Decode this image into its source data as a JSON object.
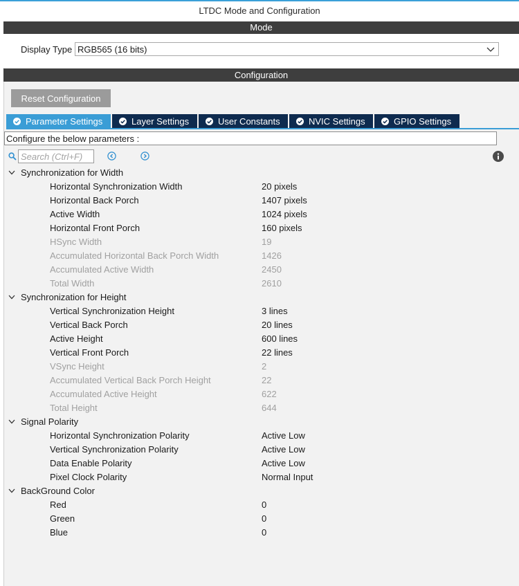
{
  "window": {
    "title": "LTDC Mode and Configuration"
  },
  "mode": {
    "header": "Mode",
    "display_type_label": "Display Type",
    "display_type_value": "RGB565 (16 bits)"
  },
  "configuration": {
    "header": "Configuration",
    "reset_button": "Reset Configuration",
    "tabs": [
      {
        "label": "Parameter Settings",
        "active": true
      },
      {
        "label": "Layer Settings",
        "active": false
      },
      {
        "label": "User Constants",
        "active": false
      },
      {
        "label": "NVIC Settings",
        "active": false
      },
      {
        "label": "GPIO Settings",
        "active": false
      }
    ],
    "info_text": "Configure the below parameters :",
    "search_placeholder": "Search (Ctrl+F)",
    "groups": [
      {
        "name": "Synchronization for Width",
        "items": [
          {
            "label": "Horizontal Synchronization Width",
            "value": "20 pixels",
            "enabled": true
          },
          {
            "label": "Horizontal Back Porch",
            "value": "1407 pixels",
            "enabled": true
          },
          {
            "label": "Active Width",
            "value": "1024 pixels",
            "enabled": true
          },
          {
            "label": "Horizontal Front Porch",
            "value": "160 pixels",
            "enabled": true
          },
          {
            "label": "HSync Width",
            "value": "19",
            "enabled": false
          },
          {
            "label": "Accumulated Horizontal Back Porch Width",
            "value": "1426",
            "enabled": false
          },
          {
            "label": "Accumulated Active Width",
            "value": "2450",
            "enabled": false
          },
          {
            "label": "Total Width",
            "value": "2610",
            "enabled": false
          }
        ]
      },
      {
        "name": "Synchronization for Height",
        "items": [
          {
            "label": "Vertical Synchronization Height",
            "value": "3 lines",
            "enabled": true
          },
          {
            "label": "Vertical Back Porch",
            "value": "20 lines",
            "enabled": true
          },
          {
            "label": "Active Height",
            "value": "600 lines",
            "enabled": true
          },
          {
            "label": "Vertical Front Porch",
            "value": "22 lines",
            "enabled": true
          },
          {
            "label": "VSync Height",
            "value": "2",
            "enabled": false
          },
          {
            "label": "Accumulated Vertical Back Porch Height",
            "value": "22",
            "enabled": false
          },
          {
            "label": "Accumulated Active Height",
            "value": "622",
            "enabled": false
          },
          {
            "label": "Total Height",
            "value": "644",
            "enabled": false
          }
        ]
      },
      {
        "name": "Signal Polarity",
        "items": [
          {
            "label": "Horizontal Synchronization Polarity",
            "value": "Active Low",
            "enabled": true
          },
          {
            "label": "Vertical Synchronization Polarity",
            "value": "Active Low",
            "enabled": true
          },
          {
            "label": "Data Enable Polarity",
            "value": "Active Low",
            "enabled": true
          },
          {
            "label": "Pixel Clock Polarity",
            "value": "Normal Input",
            "enabled": true
          }
        ]
      },
      {
        "name": "BackGround Color",
        "items": [
          {
            "label": "Red",
            "value": "0",
            "enabled": true
          },
          {
            "label": "Green",
            "value": "0",
            "enabled": true
          },
          {
            "label": "Blue",
            "value": "0",
            "enabled": true
          }
        ]
      }
    ]
  },
  "colors": {
    "header_bar": "#3e3e3e",
    "tab_active": "#3a9dd6",
    "tab_inactive": "#0e2b4f",
    "button_gray": "#9b9b9b",
    "disabled_text": "#a0a0a0",
    "panel_bg": "#f2f2f2"
  }
}
